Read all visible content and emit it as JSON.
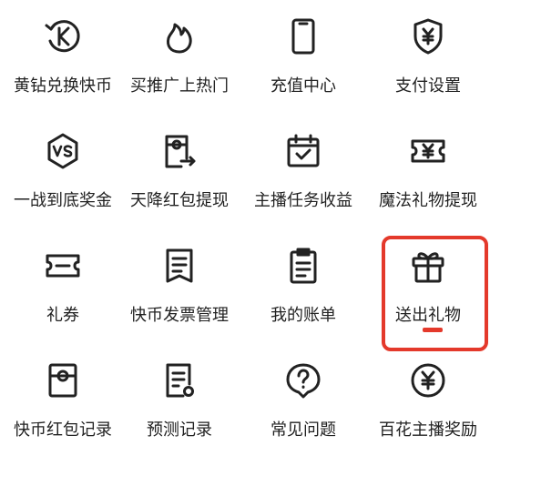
{
  "grid": {
    "items": [
      {
        "label": "黄钻兑换快币",
        "icon": "exchange-k-icon"
      },
      {
        "label": "买推广上热门",
        "icon": "flame-icon"
      },
      {
        "label": "充值中心",
        "icon": "phone-icon"
      },
      {
        "label": "支付设置",
        "icon": "shield-yen-icon"
      },
      {
        "label": "一战到底奖金",
        "icon": "vs-badge-icon"
      },
      {
        "label": "天降红包提现",
        "icon": "red-packet-withdraw-icon"
      },
      {
        "label": "主播任务收益",
        "icon": "calendar-check-icon"
      },
      {
        "label": "魔法礼物提现",
        "icon": "ticket-yen-icon"
      },
      {
        "label": "礼券",
        "icon": "coupon-icon"
      },
      {
        "label": "快币发票管理",
        "icon": "invoice-icon"
      },
      {
        "label": "我的账单",
        "icon": "bill-icon"
      },
      {
        "label": "送出礼物",
        "icon": "gift-icon"
      },
      {
        "label": "快币红包记录",
        "icon": "red-packet-record-icon"
      },
      {
        "label": "预测记录",
        "icon": "prediction-record-icon"
      },
      {
        "label": "常见问题",
        "icon": "question-icon"
      },
      {
        "label": "百花主播奖励",
        "icon": "yen-coin-icon"
      }
    ]
  },
  "colors": {
    "icon_stroke": "#222222",
    "highlight": "#e4392b"
  }
}
